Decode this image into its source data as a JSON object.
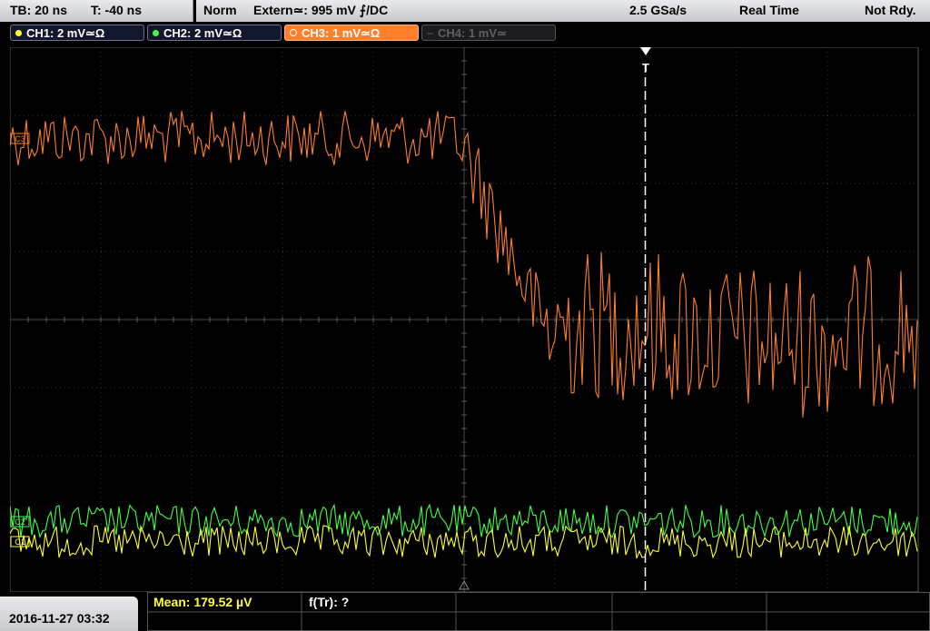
{
  "status": {
    "timebase": "TB: 20 ns",
    "trigger_time": "T: -40 ns",
    "mode": "Norm",
    "trigger_source": "Extern≃: 995 mV ⨍/DC",
    "sample_rate": "2.5 GSa/s",
    "acquisition": "Real Time",
    "state": "Not Rdy."
  },
  "channels": [
    {
      "label": "CH1: 2 mV≃Ω",
      "color": "#ffff33",
      "state": "on"
    },
    {
      "label": "CH2: 2 mV≃Ω",
      "color": "#44ff44",
      "state": "on"
    },
    {
      "label": "CH3: 1 mV≃Ω",
      "color": "#ff7f2a",
      "state": "active"
    },
    {
      "label": "CH4: 1 mV≃",
      "color": "#5c6066",
      "state": "off"
    }
  ],
  "trigger_marker": "T",
  "markers": {
    "ch3": "C3",
    "ch2": "C2",
    "ch1": "C1"
  },
  "datetime": "2016-11-27 03:32",
  "measurements": {
    "mean": "Mean: 179.52 µV",
    "rise_time": "f(Tr): ?"
  },
  "colors": {
    "ch1": "#ffff33",
    "ch2": "#44ff44",
    "ch3": "#ff7f2a",
    "grid": "#3a3a3a",
    "trigger_line": "#ffffff",
    "measure_text": "#ffff33"
  }
}
